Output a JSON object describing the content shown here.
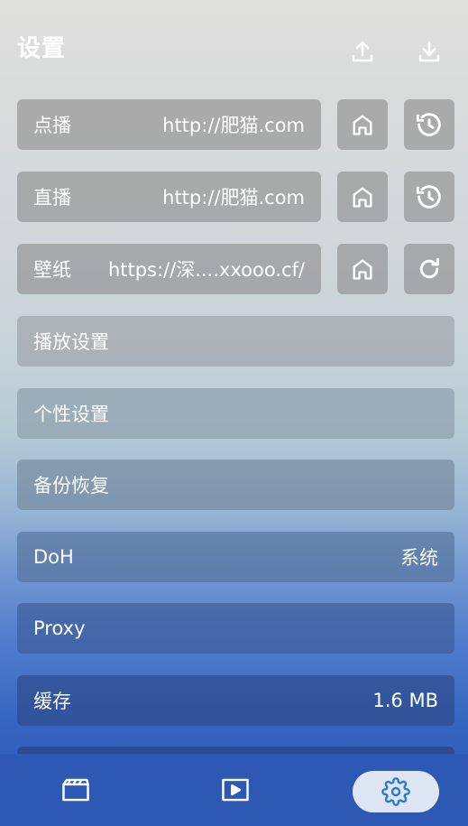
{
  "header": {
    "title": "设置",
    "upload_icon": "upload-icon",
    "download_icon": "download-icon"
  },
  "sources": [
    {
      "label": "点播",
      "url": "http://肥猫.com",
      "home_icon": "home-icon",
      "action_icon": "history-icon"
    },
    {
      "label": "直播",
      "url": "http://肥猫.com",
      "home_icon": "home-icon",
      "action_icon": "history-icon"
    },
    {
      "label": "壁纸",
      "url": "https://深....xxooo.cf/",
      "home_icon": "home-icon",
      "action_icon": "refresh-icon"
    }
  ],
  "settings": [
    {
      "label": "播放设置",
      "value": ""
    },
    {
      "label": "个性设置",
      "value": ""
    },
    {
      "label": "备份恢复",
      "value": ""
    },
    {
      "label": "DoH",
      "value": "系统"
    },
    {
      "label": "Proxy",
      "value": ""
    },
    {
      "label": "缓存",
      "value": "1.6 MB"
    }
  ],
  "nav": {
    "items": [
      "film-icon",
      "play-icon",
      "gear-icon"
    ],
    "active": "gear-icon"
  },
  "colors": {
    "accent": "#2d78d6",
    "nav_bg": "#2d58b3",
    "nav_active_bg": "#dde6f2"
  }
}
